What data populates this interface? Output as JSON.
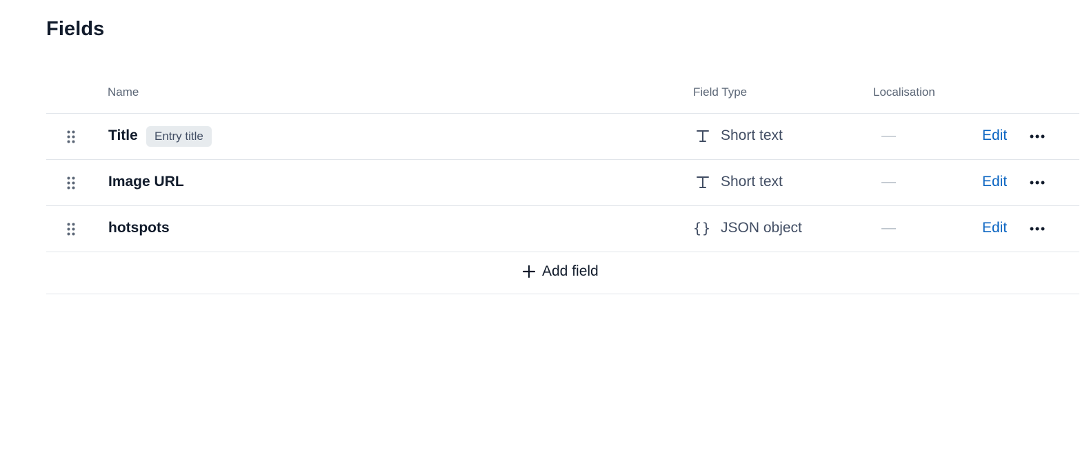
{
  "page": {
    "title": "Fields"
  },
  "table": {
    "columns": {
      "name": "Name",
      "field_type": "Field Type",
      "localisation": "Localisation"
    },
    "rows": [
      {
        "name": "Title",
        "badge": "Entry title",
        "type_icon": "text-type-icon",
        "type_label": "Short text",
        "localisation": "—",
        "edit_label": "Edit"
      },
      {
        "name": "Image URL",
        "type_icon": "text-type-icon",
        "type_label": "Short text",
        "localisation": "—",
        "edit_label": "Edit"
      },
      {
        "name": "hotspots",
        "type_icon": "json-braces-icon",
        "type_icon_glyph": "{}",
        "type_label": "JSON object",
        "localisation": "—",
        "edit_label": "Edit"
      }
    ],
    "add_field_label": "Add field"
  },
  "colors": {
    "link": "#0b65c2",
    "border": "#e1e5ea",
    "muted_text": "#5b6676",
    "badge_bg": "#e7ebee"
  }
}
